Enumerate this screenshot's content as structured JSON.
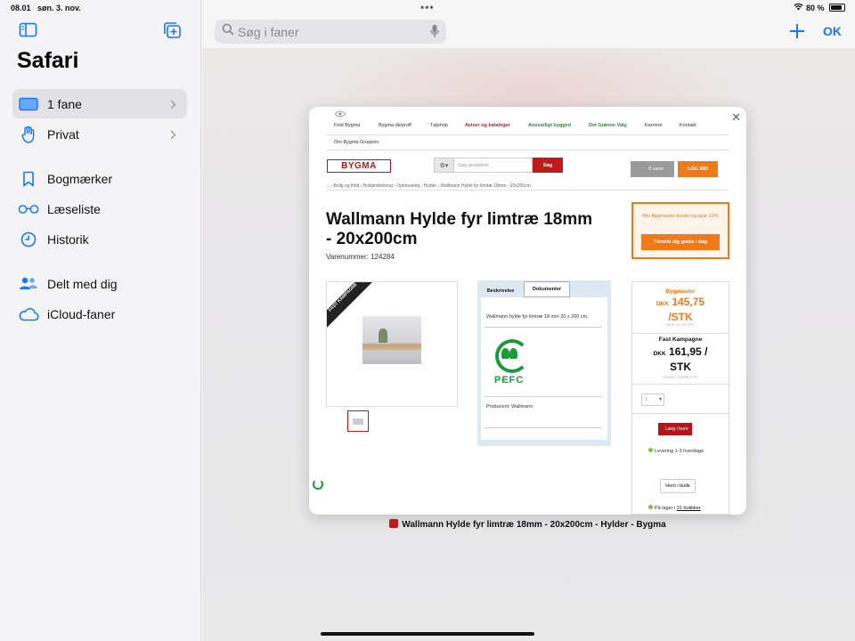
{
  "status_bar": {
    "time": "08.01",
    "date": "søn. 3. nov.",
    "battery": "80 %"
  },
  "sidebar": {
    "title": "Safari",
    "items": [
      {
        "label": "1 fane",
        "icon": "tablet-icon"
      },
      {
        "label": "Privat",
        "icon": "hand-icon"
      },
      {
        "label": "Bogmærker",
        "icon": "bookmark-icon"
      },
      {
        "label": "Læseliste",
        "icon": "glasses-icon"
      },
      {
        "label": "Historik",
        "icon": "clock-icon"
      },
      {
        "label": "Delt med dig",
        "icon": "people-icon"
      },
      {
        "label": "iCloud-faner",
        "icon": "cloud-icon"
      }
    ]
  },
  "toolbar": {
    "search_placeholder": "Søg i faner",
    "ok_label": "OK"
  },
  "tab": {
    "caption": "Wallmann Hylde fyr limtræ 18mm - 20x200cm - Hylder - Bygma",
    "page": {
      "nav": [
        "Find Bygma",
        "Bygma.dk/proff",
        "Tøjshop",
        "Aviser og kataloger",
        "Ansvarligt byggeri",
        "Det Grønne Valg",
        "Karriere",
        "Kontakt"
      ],
      "nav2": "Om Bygma Gruppen",
      "logo": "BYGMA",
      "search_placeholder": "Søg produkter",
      "search_button": "Søg",
      "cart": "0 varer",
      "login": "LOG IND",
      "breadcrumb": "⌂  ›  Bolig og fritid  ›  Boligindretning  ›  Opbevaring  ›  Hylder  ›  Wallmann Hylde fyr limtræ 18mm - 20x200cm",
      "title": "Wallmann Hylde fyr limtræ 18mm - 20x200cm",
      "sku": "Varenummer: 124284",
      "promo_text": "Bliv Bygmaster kunde og spar 10%",
      "promo_button": "Tilmeld dig gratis i dag",
      "ribbon": "FAST KAMPAGNE",
      "tab_description": "Beskrivelse",
      "tab_documents": "Dokumenter",
      "description": "Wallmann hylde fyr limtræ 18 mm 20 x 200 cm.",
      "pefc": "PEFC",
      "producer": "Producent: Wallmann",
      "bygmaster_label": "Bygmaster",
      "bygmaster_currency": "DKK",
      "bygmaster_price": "145,75",
      "bygmaster_unit": "/STK",
      "bygmaster_note": "Spar 16,20 STK",
      "campaign_label": "Fast Kampagne",
      "campaign_currency": "DKK",
      "campaign_price": "161,95",
      "campaign_unit": "STK",
      "campaign_note": "Førpris 129,95 STK",
      "quantity": "1",
      "add_to_cart": "Læg i kurv",
      "delivery": "Levering 1-3 hverdage",
      "pickup": "Hent i butik",
      "stock_prefix": "På lager i",
      "stock_link": "31 butikker"
    }
  }
}
